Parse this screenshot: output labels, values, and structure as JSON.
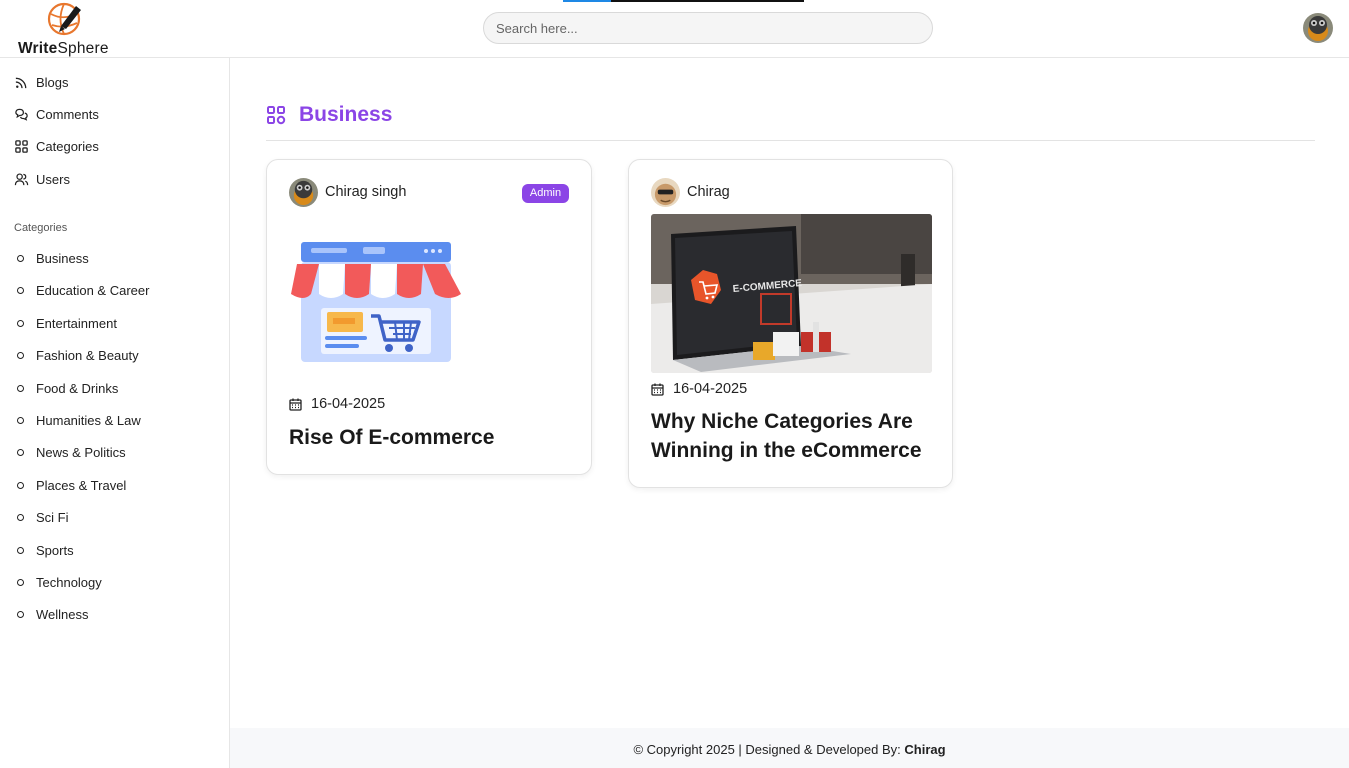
{
  "header": {
    "logo_bold": "Write",
    "logo_rest": "Sphere",
    "search_placeholder": "Search here..."
  },
  "sidebar": {
    "nav": [
      {
        "label": "Blogs",
        "icon": "rss-icon"
      },
      {
        "label": "Comments",
        "icon": "comments-icon"
      },
      {
        "label": "Categories",
        "icon": "grid-icon"
      },
      {
        "label": "Users",
        "icon": "users-icon"
      }
    ],
    "categories_heading": "Categories",
    "categories": [
      "Business",
      "Education & Career",
      "Entertainment",
      "Fashion & Beauty",
      "Food & Drinks",
      "Humanities & Law",
      "News & Politics",
      "Places & Travel",
      "Sci Fi",
      "Sports",
      "Technology",
      "Wellness"
    ]
  },
  "main": {
    "title": "Business",
    "accent_color": "#8b45e6",
    "posts": [
      {
        "author": "Chirag singh",
        "badge": "Admin",
        "date": "16-04-2025",
        "title": "Rise Of E-commerce",
        "image_icon": "storefront-cart-illustration"
      },
      {
        "author": "Chirag",
        "date": "16-04-2025",
        "title": "Why Niche Categories Are Winning in the eCommerce",
        "image_icon": "laptop-ecommerce-photo",
        "image_text": "E-COMMERCE"
      }
    ]
  },
  "footer": {
    "text": "© Copyright 2025 | Designed & Developed By: ",
    "author": "Chirag"
  }
}
